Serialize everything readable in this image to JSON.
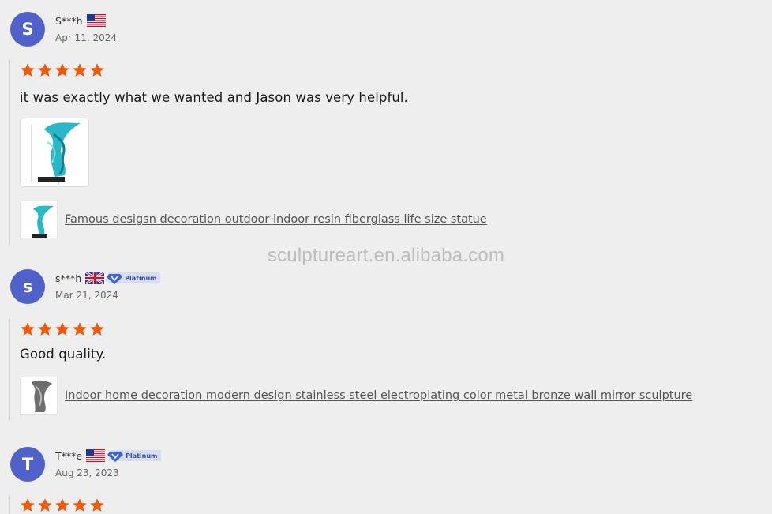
{
  "watermark": "sculptureart.en.alibaba.com",
  "colors": {
    "avatar": "#5061c9",
    "star": "#f05a0a",
    "badge_bg": "#d6dcf2",
    "badge_text": "#3c4c9c"
  },
  "reviews": [
    {
      "avatar_letter": "S",
      "name": "S***h",
      "flag_icon": "usa-flag-icon",
      "badge": "",
      "date": "Apr 11, 2024",
      "rating": 5,
      "text": "it was exactly what we wanted and Jason was very helpful.",
      "product_title": "Famous desigsn decoration outdoor indoor resin fiberglass life size statue"
    },
    {
      "avatar_letter": "s",
      "name": "s***h",
      "flag_icon": "uk-flag-icon",
      "badge": "Platinum",
      "date": "Mar 21, 2024",
      "rating": 5,
      "text": "Good quality.",
      "product_title": "Indoor home decoration modern design stainless steel electroplating color metal bronze wall mirror sculpture"
    },
    {
      "avatar_letter": "T",
      "name": "T***e",
      "flag_icon": "usa-flag-icon",
      "badge": "Platinum",
      "date": "Aug 23, 2023",
      "rating": 5
    }
  ]
}
